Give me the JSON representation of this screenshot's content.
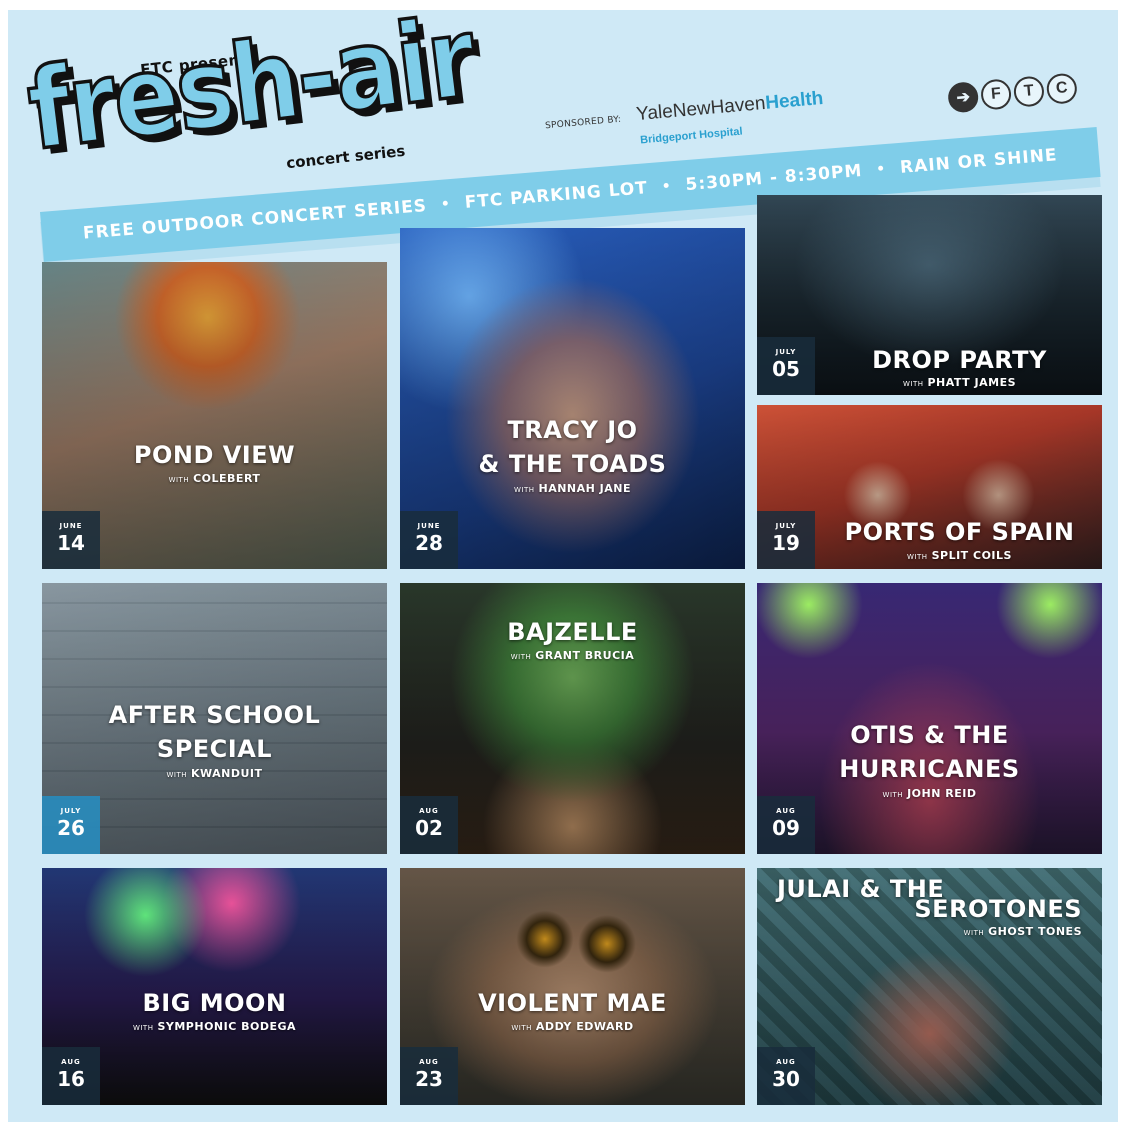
{
  "header": {
    "presents": "FTC presents",
    "title": "fresh-air",
    "subtitle": "concert series",
    "sponsored_by": "SPONSORED BY:",
    "sponsor_main": "YaleNewHaven",
    "sponsor_highlight": "Health",
    "sponsor_sub": "Bridgeport Hospital",
    "logo_letters": [
      "F",
      "T",
      "C"
    ],
    "logo_icon": "arrow-right-icon"
  },
  "banner": {
    "items": [
      "FREE OUTDOOR CONCERT SERIES",
      "FTC PARKING LOT",
      "5:30PM - 8:30PM",
      "RAIN OR SHINE"
    ],
    "separator": "•"
  },
  "colors": {
    "background": "#cfe9f6",
    "accent": "#7fcde9",
    "date_box": "#192d3c",
    "date_box_highlight": "#288cbe"
  },
  "concerts": [
    {
      "band": "POND VIEW",
      "with_word": "WITH",
      "opener": "COLEBERT",
      "month": "JUNE",
      "day": "14"
    },
    {
      "band": "TRACY JO",
      "band_line2": "& THE TOADS",
      "with_word": "WITH",
      "opener": "HANNAH JANE",
      "month": "JUNE",
      "day": "28"
    },
    {
      "band": "DROP PARTY",
      "with_word": "WITH",
      "opener": "PHATT JAMES",
      "month": "JULY",
      "day": "05"
    },
    {
      "band": "PORTS OF SPAIN",
      "with_word": "WITH",
      "opener": "SPLIT COILS",
      "month": "JULY",
      "day": "19"
    },
    {
      "band": "AFTER SCHOOL",
      "band_line2": "SPECIAL",
      "with_word": "WITH",
      "opener": "KWANDUIT",
      "month": "JULY",
      "day": "26"
    },
    {
      "band": "BAJZELLE",
      "with_word": "WITH",
      "opener": "GRANT BRUCIA",
      "month": "AUG",
      "day": "02"
    },
    {
      "band": "OTIS & THE",
      "band_line2": "HURRICANES",
      "with_word": "WITH",
      "opener": "JOHN REID",
      "month": "AUG",
      "day": "09"
    },
    {
      "band": "BIG MOON",
      "with_word": "WITH",
      "opener": "SYMPHONIC BODEGA",
      "month": "AUG",
      "day": "16"
    },
    {
      "band": "VIOLENT MAE",
      "with_word": "WITH",
      "opener": "ADDY EDWARD",
      "month": "AUG",
      "day": "23"
    },
    {
      "band": "JULAI & THE",
      "band_line2": "SEROTONES",
      "with_word": "WITH",
      "opener": "GHOST TONES",
      "month": "AUG",
      "day": "30"
    }
  ]
}
